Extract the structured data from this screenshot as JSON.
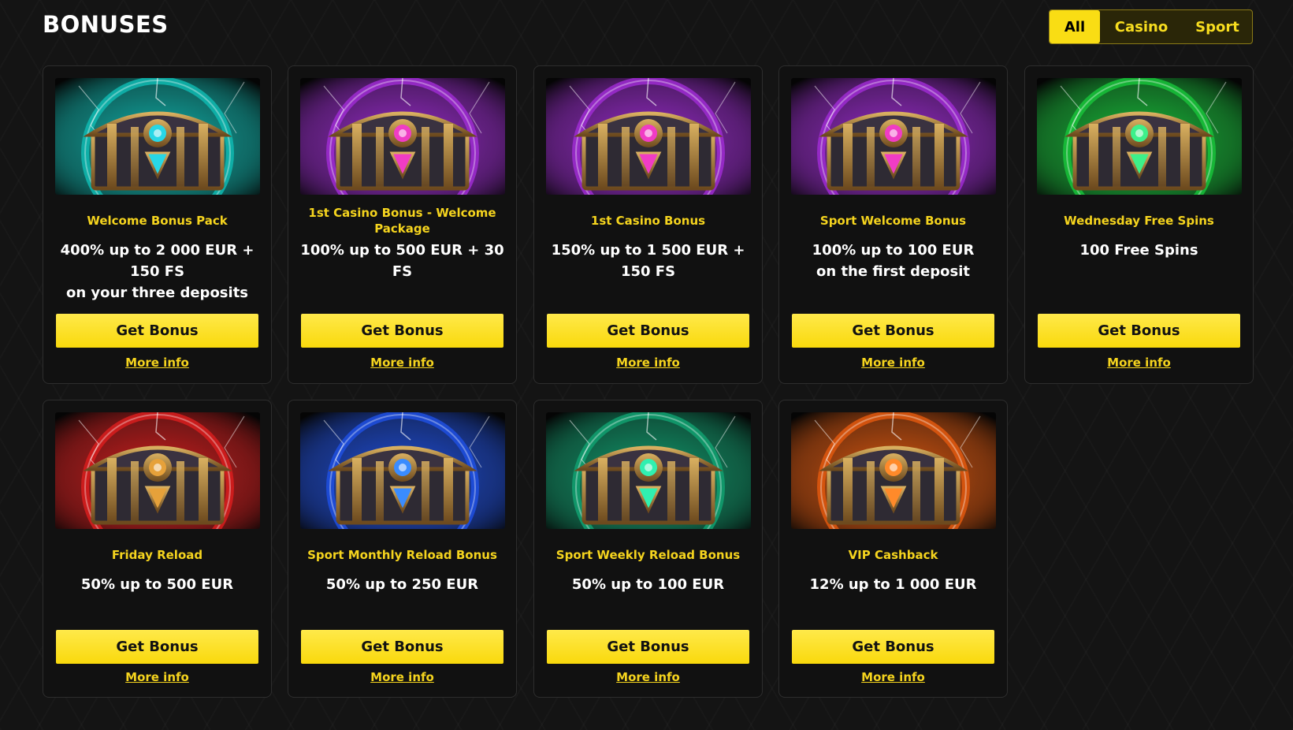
{
  "page": {
    "title": "BONUSES"
  },
  "filters": [
    {
      "label": "All",
      "active": true
    },
    {
      "label": "Casino",
      "active": false
    },
    {
      "label": "Sport",
      "active": false
    }
  ],
  "cards": [
    {
      "name": "Welcome Bonus Pack",
      "desc": "400% up to 2 000 EUR + 150 FS\non your three deposits",
      "button": "Get Bonus",
      "more": "More info",
      "theme": "#0fb8b0",
      "gem": "#28d7e6"
    },
    {
      "name": "1st Casino Bonus - Welcome Package",
      "desc": "100% up to 500 EUR + 30 FS",
      "button": "Get Bonus",
      "more": "More info",
      "theme": "#9d2bd1",
      "gem": "#f03cc5"
    },
    {
      "name": "1st Casino Bonus",
      "desc": "150% up to 1 500 EUR + 150 FS",
      "button": "Get Bonus",
      "more": "More info",
      "theme": "#9d2bd1",
      "gem": "#f03cc5"
    },
    {
      "name": "Sport Welcome Bonus",
      "desc": "100% up to 100 EUR\non the first deposit",
      "button": "Get Bonus",
      "more": "More info",
      "theme": "#9d2bd1",
      "gem": "#f03cc5"
    },
    {
      "name": "Wednesday Free Spins",
      "desc": "100 Free Spins",
      "button": "Get Bonus",
      "more": "More info",
      "theme": "#17c23a",
      "gem": "#3df08a"
    },
    {
      "name": "Friday Reload",
      "desc": "50% up to 500 EUR",
      "button": "Get Bonus",
      "more": "More info",
      "theme": "#d81d1d",
      "gem": "#e6a13a"
    },
    {
      "name": "Sport Monthly Reload Bonus",
      "desc": "50% up to 250 EUR",
      "button": "Get Bonus",
      "more": "More info",
      "theme": "#1e4fe0",
      "gem": "#3a8cff"
    },
    {
      "name": "Sport Weekly Reload Bonus",
      "desc": "50% up to 100 EUR",
      "button": "Get Bonus",
      "more": "More info",
      "theme": "#10a070",
      "gem": "#30f0b0"
    },
    {
      "name": "VIP Cashback",
      "desc": "12% up to 1 000 EUR",
      "button": "Get Bonus",
      "more": "More info",
      "theme": "#e0580e",
      "gem": "#ff8a2a"
    }
  ]
}
